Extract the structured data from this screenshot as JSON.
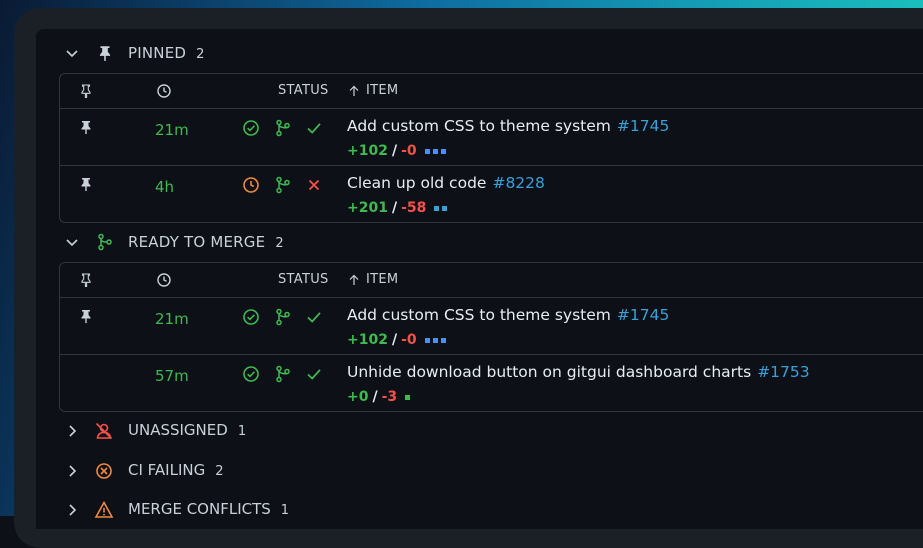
{
  "sections": {
    "pinned": {
      "title": "PINNED",
      "count": "2"
    },
    "ready": {
      "title": "READY TO MERGE",
      "count": "2"
    },
    "unassigned": {
      "title": "UNASSIGNED",
      "count": "1"
    },
    "ci_failing": {
      "title": "CI FAILING",
      "count": "2"
    },
    "merge_conflicts": {
      "title": "MERGE CONFLICTS",
      "count": "1"
    }
  },
  "table_header": {
    "status": "STATUS",
    "item": "ITEM"
  },
  "pinned_rows": [
    {
      "age": "21m",
      "title": "Add custom CSS to theme system",
      "number": "#1745",
      "additions": "+102",
      "deletions": "-0",
      "ci": "success",
      "check": "success",
      "blocks": 3
    },
    {
      "age": "4h",
      "title": "Clean up old code",
      "number": "#8228",
      "additions": "+201",
      "deletions": "-58",
      "ci": "pending",
      "check": "failure",
      "blocks": 2
    }
  ],
  "ready_rows": [
    {
      "age": "21m",
      "title": "Add custom CSS to theme system",
      "number": "#1745",
      "additions": "+102",
      "deletions": "-0",
      "ci": "success",
      "check": "success",
      "blocks": 3
    },
    {
      "age": "57m",
      "title": "Unhide download button on gitgui dashboard charts",
      "number": "#1753",
      "additions": "+0",
      "deletions": "-3",
      "ci": "success",
      "check": "success",
      "blocks": 1
    }
  ],
  "icons": {
    "chevron": "chevron-icon",
    "pin": "pin-icon",
    "merge": "git-merge-icon",
    "clock": "clock-icon",
    "unassigned": "person-slash-icon",
    "ci_failing": "x-circle-icon",
    "conflict": "alert-triangle-icon"
  },
  "colors": {
    "success": "#3fb950",
    "failure": "#f85149",
    "pending": "#f0883e",
    "link": "#39a0d8",
    "border": "#30363d"
  }
}
